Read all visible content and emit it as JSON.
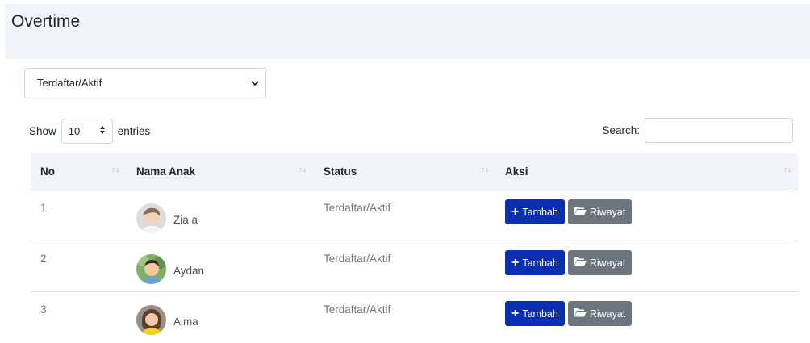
{
  "page": {
    "title": "Overtime"
  },
  "filter": {
    "selected": "Terdaftar/Aktif"
  },
  "datatable": {
    "show_label": "Show",
    "length_value": "10",
    "entries_label": "entries",
    "search_label": "Search:",
    "search_value": ""
  },
  "table": {
    "headers": [
      "No",
      "Nama Anak",
      "Status",
      "Aksi"
    ],
    "rows": [
      {
        "no": "1",
        "name": "Zia a",
        "status": "Terdaftar/Aktif"
      },
      {
        "no": "2",
        "name": "Aydan",
        "status": "Terdaftar/Aktif"
      },
      {
        "no": "3",
        "name": "Aima",
        "status": "Terdaftar/Aktif"
      }
    ],
    "actions": {
      "add_label": "Tambah",
      "history_label": "Riwayat"
    }
  },
  "colors": {
    "header_bg": "#f1f4f8",
    "add_button": "#0a2fb0",
    "history_button": "#6c757d"
  },
  "icons": {
    "filter_chevron": "chevron-down-icon",
    "length_arrows": "sort-arrows-icon",
    "column_sort": "sort-icon",
    "add": "plus-icon",
    "history": "folder-open-icon"
  }
}
